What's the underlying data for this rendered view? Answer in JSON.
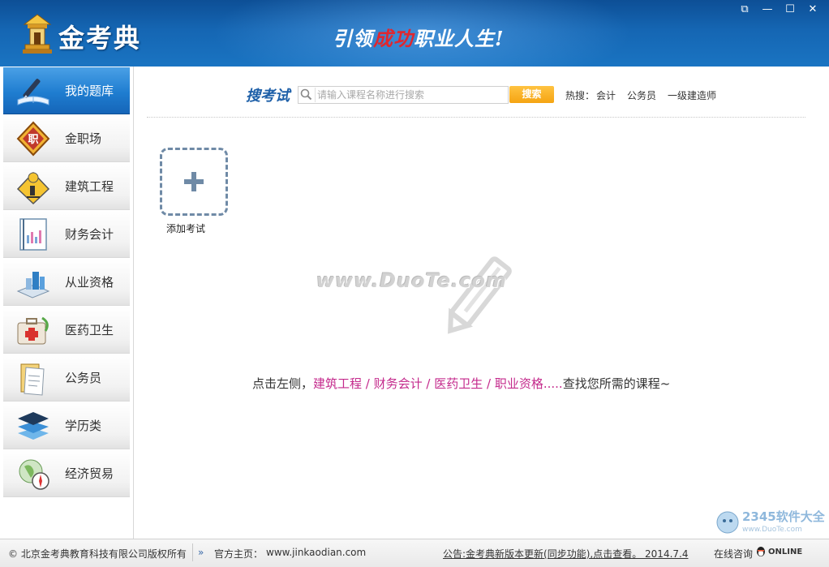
{
  "header": {
    "logo_text": "金考典",
    "slogan_part1": "引领",
    "slogan_highlight": "成功",
    "slogan_part2": "职业人生!",
    "window_buttons": {
      "restore": "⧉",
      "minimize": "—",
      "maximize": "☐",
      "close": "✕"
    }
  },
  "sidebar": {
    "items": [
      {
        "label": "我的题库",
        "icon": "pen-book-icon",
        "active": true
      },
      {
        "label": "金职场",
        "icon": "job-badge-icon"
      },
      {
        "label": "建筑工程",
        "icon": "construction-worker-icon"
      },
      {
        "label": "财务会计",
        "icon": "ledger-chart-icon"
      },
      {
        "label": "从业资格",
        "icon": "certificate-books-icon"
      },
      {
        "label": "医药卫生",
        "icon": "medical-kit-icon"
      },
      {
        "label": "公务员",
        "icon": "documents-icon"
      },
      {
        "label": "学历类",
        "icon": "stacked-layers-icon"
      },
      {
        "label": "经济贸易",
        "icon": "globe-compass-icon"
      }
    ]
  },
  "search": {
    "title": "搜考试",
    "placeholder": "请输入课程名称进行搜索",
    "button": "搜索",
    "hot_label": "热搜：",
    "hot_items": [
      "会计",
      "公务员",
      "一级建造师"
    ]
  },
  "main": {
    "add_label": "添加考试",
    "watermark": "www.DuoTe.com",
    "hint_prefix": "点击左侧，",
    "hint_links": [
      "建筑工程",
      "财务会计",
      "医药卫生",
      "职业资格"
    ],
    "hint_sep": " / ",
    "hint_suffix": "查找您所需的课程~",
    "hint_dots": "....."
  },
  "badge": {
    "text": "2345软件大全",
    "url_text": "www.DuoTe.com"
  },
  "footer": {
    "copyright": "© 北京金考典教育科技有限公司版权所有",
    "homepage_label": "官方主页：",
    "homepage_url": "www.jinkaodian.com",
    "notice": "公告:金考典新版本更新(同步功能),点击查看。 2014.7.4",
    "online_label": "在线咨询",
    "online_badge": "ONLINE"
  },
  "colors": {
    "header_blue": "#1566b3",
    "active_blue": "#1f7dd0",
    "link_magenta": "#c42a8c",
    "search_button": "#f5a412",
    "slogan_red": "#e0272f"
  }
}
